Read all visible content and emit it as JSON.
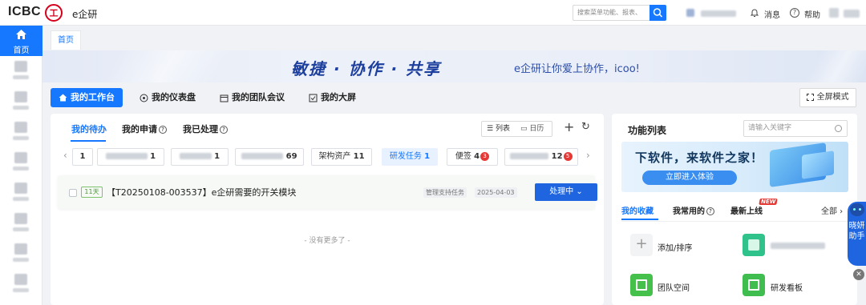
{
  "header": {
    "logo": "ICBC",
    "seal": "工",
    "app_name": "e企研",
    "search_placeholder": "搜索菜单功能、报表、",
    "messages": "消息",
    "help": "帮助"
  },
  "sidebar": {
    "home": "首页"
  },
  "tabs": {
    "home_tab": "首页"
  },
  "banner": {
    "slogan": "敏捷 · 协作 · 共享",
    "sub": "e企研让你爱上协作，icoo!"
  },
  "mode_tabs": [
    "我的工作台",
    "我的仪表盘",
    "我的团队会议",
    "我的大屏"
  ],
  "fullscreen": "全屏模式",
  "work": {
    "subtabs": [
      "我的待办",
      "我的申请",
      "我已处理"
    ],
    "view_list": "列表",
    "view_calendar": "日历",
    "chips": [
      {
        "label": "",
        "count": "1"
      },
      {
        "label": "",
        "count": "1"
      },
      {
        "label": "",
        "count": "1"
      },
      {
        "label": "",
        "count": "69"
      },
      {
        "label": "架构资产",
        "count": "11"
      },
      {
        "label": "研发任务",
        "count": "1"
      },
      {
        "label": "便签",
        "count": "4",
        "badge": "3"
      },
      {
        "label": "",
        "count": "12",
        "badge": "5"
      }
    ],
    "task": {
      "days": "11天",
      "title": "【T20250108-003537】e企研需要的开关模块",
      "tag": "管理支持任务",
      "date": "2025-04-03",
      "action": "处理中"
    },
    "no_more": "- 没有更多了 -"
  },
  "functions": {
    "title": "功能列表",
    "search_placeholder": "请输入关键字",
    "ad_title": "下软件，来软件之家！",
    "ad_button": "立即进入体验",
    "tabs": [
      "我的收藏",
      "我常用的",
      "最新上线"
    ],
    "new_badge": "NEW",
    "all": "全部",
    "items": [
      "添加/排序",
      "",
      "团队空间",
      "研发看板"
    ]
  },
  "helper": "晓妍助手",
  "colors": {
    "primary": "#1677ff",
    "brand_red": "#d6001c"
  }
}
